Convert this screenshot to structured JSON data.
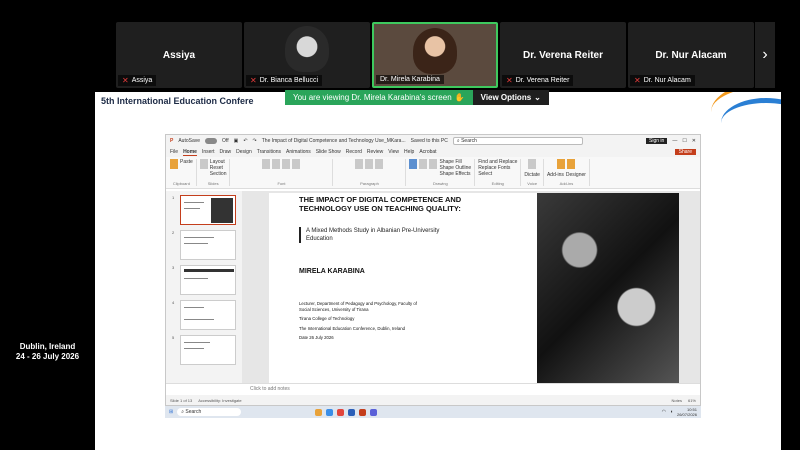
{
  "participants": [
    {
      "display_name": "Assiya",
      "tag": "Assiya",
      "muted": true,
      "video": false
    },
    {
      "display_name": "",
      "tag": "Dr. Bianca Bellucci",
      "muted": true,
      "video": true
    },
    {
      "display_name": "",
      "tag": "Dr. Mirela Karabina",
      "muted": false,
      "video": true,
      "active": true
    },
    {
      "display_name": "Dr. Verena Reiter",
      "tag": "Dr. Verena Reiter",
      "muted": true,
      "video": false
    },
    {
      "display_name": "Dr. Nur Alacam",
      "tag": "Dr. Nur Alacam",
      "muted": true,
      "video": false
    }
  ],
  "share_banner": {
    "message": "You are viewing  Dr. Mirela Karabina's screen",
    "view_options": "View Options"
  },
  "conference": {
    "title": "5th International Education Confere",
    "city": "Dublin, Ireland",
    "dates": "24 - 26 July 2026"
  },
  "ppt": {
    "autosave": "AutoSave",
    "toggle_state": "Off",
    "doc_title": "The Impact of Digital Competence and Technology Use_MKara...",
    "save_state": "Saved to this PC",
    "search_placeholder": "Search",
    "signin": "Sign in",
    "share": "Share",
    "tabs": [
      "File",
      "Home",
      "Insert",
      "Draw",
      "Design",
      "Transitions",
      "Animations",
      "Slide Show",
      "Record",
      "Review",
      "View",
      "Help",
      "Acrobat"
    ],
    "ribbon_groups": [
      "Clipboard",
      "Slides",
      "Font",
      "Paragraph",
      "Drawing",
      "Editing",
      "Voice",
      "Add-ins"
    ],
    "ribbon_labels": {
      "paste": "Paste",
      "new_slide": "New Slide",
      "layout": "Layout",
      "reset": "Reset",
      "section": "Section",
      "shapes": "Shapes",
      "arrange": "Arrange",
      "quick_styles": "Quick Styles",
      "shape_fill": "Shape Fill",
      "shape_outline": "Shape Outline",
      "shape_effects": "Shape Effects",
      "find_replace": "Find and Replace",
      "replace_fonts": "Replace Fonts",
      "select": "Select",
      "dictate": "Dictate",
      "addins": "Add-ins",
      "designer": "Designer"
    },
    "slide": {
      "title": "THE IMPACT OF DIGITAL COMPETENCE AND TECHNOLOGY USE ON TEACHING QUALITY:",
      "subtitle": "A Mixed Methods Study in Albanian Pre-University Education",
      "author": "MIRELA KARABINA",
      "affiliation1": "Lecturer, Department of Pedagogy and Psychology, Faculty of Social Sciences, University of Tirana",
      "affiliation2": "Tirana College of Technology",
      "affiliation3": "The International Education Conference, Dublin, Ireland",
      "date": "Date 26 July 2026"
    },
    "thumb_numbers": [
      "1",
      "2",
      "3",
      "4",
      "5",
      "6"
    ],
    "notes_placeholder": "Click to add notes",
    "status": {
      "slide_of": "Slide 1 of 13",
      "accessibility": "Accessibility: Investigate",
      "notes": "Notes",
      "zoom": "61%"
    }
  },
  "taskbar": {
    "search": "Search",
    "time": "10:51",
    "date": "26/07/2026"
  },
  "colors": {
    "active_border": "#3ec95e",
    "banner_green": "#2aa55a",
    "ppt_accent": "#c43e1c",
    "arc_orange": "#f39a1e",
    "arc_blue": "#2a7fd4"
  }
}
